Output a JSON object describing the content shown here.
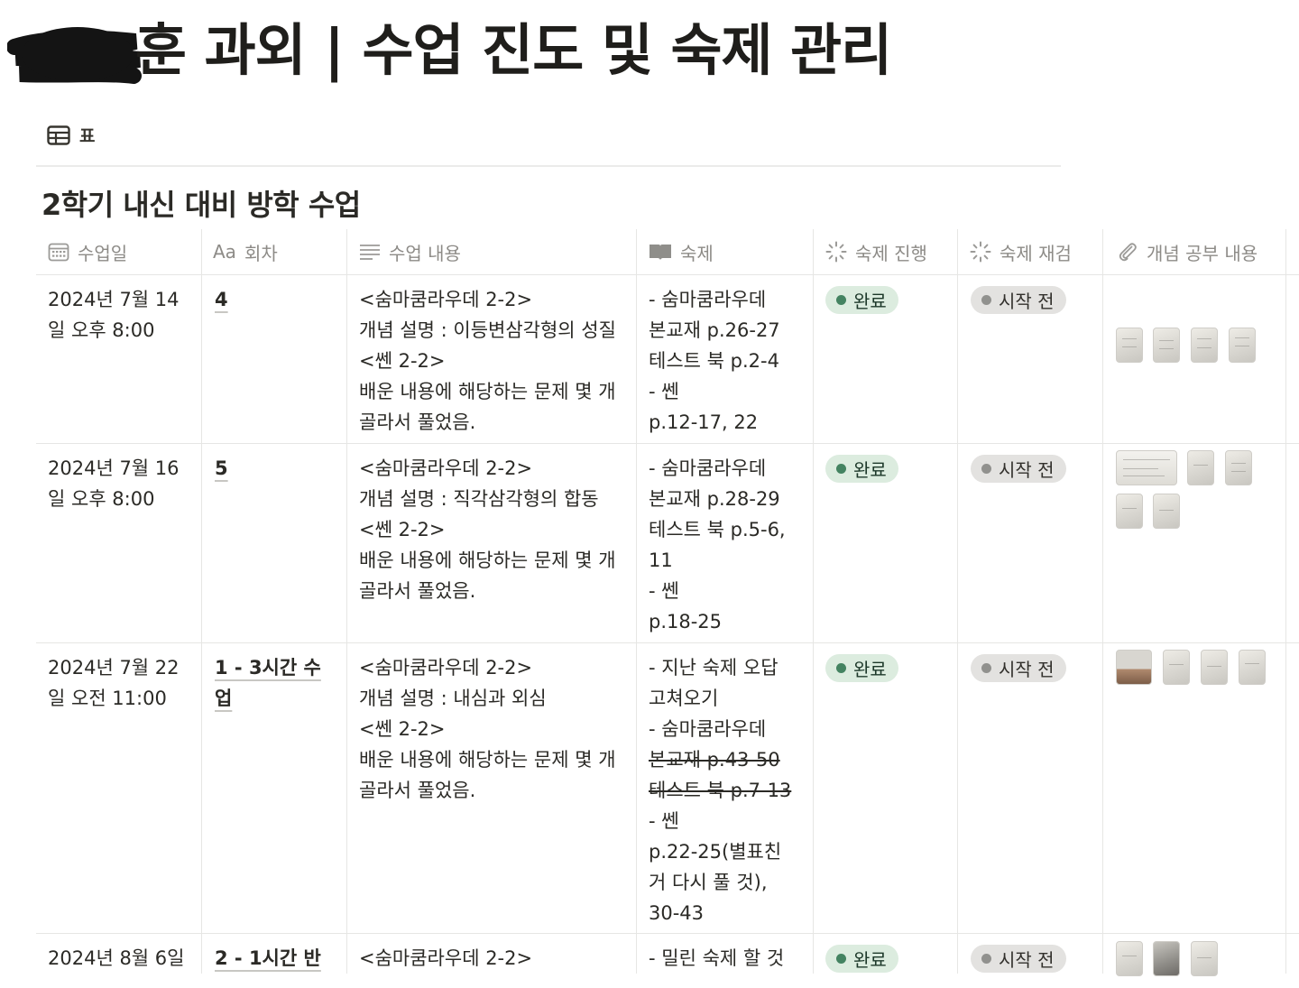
{
  "page": {
    "title": "훈 과외 | 수업 진도 및 숙제 관리",
    "view_tab_label": "표",
    "database_title": "2학기 내신 대비 방학 수업"
  },
  "colors": {
    "status_done_bg": "#dcecdf",
    "status_done_dot": "#448361",
    "status_not_started_bg": "#e3e2e0",
    "status_not_started_dot": "#91918e"
  },
  "columns": [
    {
      "label": "수업일",
      "icon": "calendar-icon"
    },
    {
      "label": "회차",
      "icon": "title-aa-icon",
      "icon_text": "Aa"
    },
    {
      "label": "수업 내용",
      "icon": "text-lines-icon"
    },
    {
      "label": "숙제",
      "icon": "book-icon"
    },
    {
      "label": "숙제 진행",
      "icon": "status-spinner-icon"
    },
    {
      "label": "숙제 재검",
      "icon": "status-spinner-icon"
    },
    {
      "label": "개념 공부 내용",
      "icon": "paperclip-icon"
    }
  ],
  "rows": [
    {
      "date": [
        "2024년 7월 14",
        "일 오후 8:00"
      ],
      "session": [
        "4"
      ],
      "content": [
        "<숨마쿰라우데 2-2>",
        "개념 설명 : 이등변삼각형의 성질",
        "<쎈 2-2>",
        "배운 내용에 해당하는 문제 몇 개",
        "골라서 풀었음."
      ],
      "homework": [
        {
          "text": "- 숨마쿰라우데",
          "strike": false
        },
        {
          "text": "본교재 p.26-27",
          "strike": false
        },
        {
          "text": "테스트 북 p.2-4",
          "strike": false
        },
        {
          "text": "- 쎈",
          "strike": false
        },
        {
          "text": "p.12-17, 22",
          "strike": false
        }
      ],
      "progress": "완료",
      "recheck": "시작 전",
      "attachments": 4
    },
    {
      "date": [
        "2024년 7월 16",
        "일 오후 8:00"
      ],
      "session": [
        "5"
      ],
      "content": [
        "<숨마쿰라우데 2-2>",
        "개념 설명 : 직각삼각형의 합동",
        "<쎈 2-2>",
        "배운 내용에 해당하는 문제 몇 개",
        "골라서 풀었음."
      ],
      "homework": [
        {
          "text": "- 숨마쿰라우데",
          "strike": false
        },
        {
          "text": "본교재 p.28-29",
          "strike": false
        },
        {
          "text": "테스트 북 p.5-6,",
          "strike": false
        },
        {
          "text": "11",
          "strike": false
        },
        {
          "text": "- 쎈",
          "strike": false
        },
        {
          "text": "p.18-25",
          "strike": false
        }
      ],
      "progress": "완료",
      "recheck": "시작 전",
      "attachments": 5
    },
    {
      "date": [
        "2024년 7월 22",
        "일 오전 11:00"
      ],
      "session": [
        "1 - 3시간 수",
        "업"
      ],
      "content": [
        "<숨마쿰라우데 2-2>",
        "개념 설명 : 내심과 외심",
        "<쎈 2-2>",
        "배운 내용에 해당하는 문제 몇 개",
        "골라서 풀었음."
      ],
      "homework": [
        {
          "text": "- 지난 숙제 오답",
          "strike": false
        },
        {
          "text": "고쳐오기",
          "strike": false
        },
        {
          "text": "- 숨마쿰라우데",
          "strike": false
        },
        {
          "text": "본교재 p.43-50",
          "strike": true
        },
        {
          "text": "테스트 북 p.7-13",
          "strike": true
        },
        {
          "text": "- 쎈",
          "strike": false
        },
        {
          "text": "p.22-25(별표친",
          "strike": false
        },
        {
          "text": "거 다시 풀 것),",
          "strike": false
        },
        {
          "text": "30-43",
          "strike": false
        }
      ],
      "progress": "완료",
      "recheck": "시작 전",
      "attachments": 4
    },
    {
      "date": [
        "2024년 8월 6일"
      ],
      "session": [
        "2 - 1시간 반"
      ],
      "content": [
        "<숨마쿰라우데 2-2>"
      ],
      "homework": [
        {
          "text": "- 밀린 숙제 할 것",
          "strike": false
        }
      ],
      "progress": "완료",
      "recheck": "시작 전",
      "attachments": 3
    }
  ]
}
